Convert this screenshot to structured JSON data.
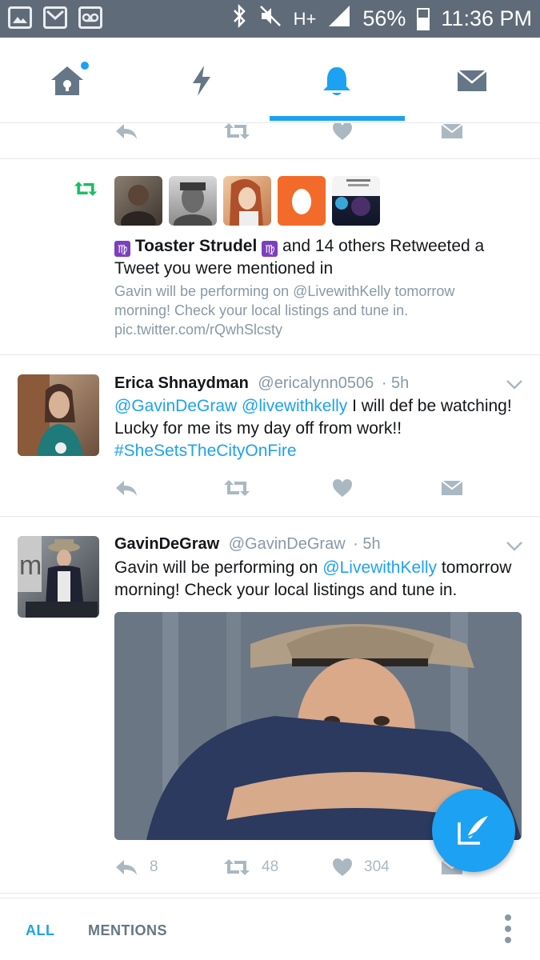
{
  "status_bar": {
    "icons_left": [
      "gallery-icon",
      "gmail-icon",
      "voicemail-icon"
    ],
    "icons_right": [
      "bluetooth-icon",
      "mute-icon",
      "network-icon",
      "signal-icon",
      "battery-icon"
    ],
    "network_type": "H+",
    "battery": "56%",
    "time": "11:36 PM"
  },
  "top_nav": {
    "tabs": [
      {
        "name": "home",
        "icon": "home-icon",
        "has_dot": true
      },
      {
        "name": "moments",
        "icon": "lightning-icon"
      },
      {
        "name": "notifications",
        "icon": "bell-icon",
        "active": true
      },
      {
        "name": "messages",
        "icon": "envelope-icon"
      }
    ]
  },
  "colors": {
    "accent": "#1da1f2",
    "retweet_green": "#17bf63",
    "muted": "#8899a6",
    "icon_gray": "#aab8c2",
    "status_bar": "#5f6b78"
  },
  "retweet_notification": {
    "icon": "retweet-icon",
    "avatars": [
      "avatar-1",
      "avatar-2",
      "avatar-3",
      "avatar-egg",
      "avatar-5"
    ],
    "user_name": "Toaster Strudel",
    "name_emoji": "♍",
    "rest_of_text": "and 14 others Retweeted a Tweet you were mentioned in",
    "quoted_text": "Gavin will be performing on @LivewithKelly tomorrow morning! Check your local listings and tune in. pic.twitter.com/rQwhSlcsty"
  },
  "tweets": [
    {
      "name": "Erica Shnaydman",
      "handle": "@ericalynn0506",
      "time": "· 5h",
      "mention1": "@GavinDeGraw",
      "mention2": "@livewithkelly",
      "text_plain": "I will def be watching! Lucky for me its my day off from work!!",
      "hashtag": "#SheSetsTheCityOnFire"
    },
    {
      "name": "GavinDeGraw",
      "handle": "@GavinDeGraw",
      "time": "· 5h",
      "text_before": "Gavin will be performing on",
      "mention": "@LivewithKelly",
      "text_after": "tomorrow morning! Check your local listings and tune in.",
      "counts": {
        "replies": "8",
        "retweets": "48",
        "likes": "304"
      }
    }
  ],
  "bottom_tabs": {
    "all": "ALL",
    "mentions": "MENTIONS"
  }
}
